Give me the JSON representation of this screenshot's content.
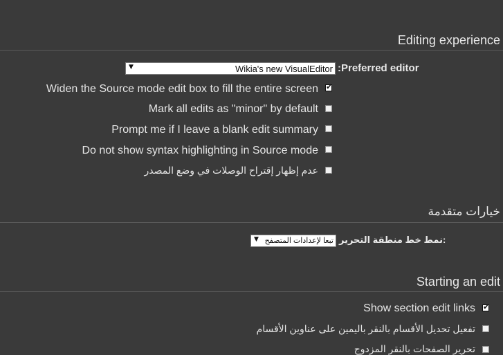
{
  "sections": {
    "editing_title": "Editing experience",
    "advanced_title": "خيارات متقدمة",
    "starting_title": "Starting an edit"
  },
  "preferred_editor": {
    "label": ":Preferred editor",
    "value": "Wikia's new VisualEditor"
  },
  "editing_options": [
    {
      "label": "Widen the Source mode edit box to fill the entire screen",
      "checked": true
    },
    {
      "label": "Mark all edits as \"minor\" by default",
      "checked": false
    },
    {
      "label": "Prompt me if I leave a blank edit summary",
      "checked": false
    },
    {
      "label": "Do not show syntax highlighting in Source mode",
      "checked": false
    },
    {
      "label": "عدم إظهار إقتراح الوصلات في وضع المصدر",
      "checked": false
    }
  ],
  "font_style": {
    "label": "نمط خط منطقة التحرير:",
    "value": "تبعا لإعدادات المتصفح"
  },
  "starting_options": [
    {
      "label": "Show section edit links",
      "checked": true
    },
    {
      "label": "تفعيل تحديل الأقسام بالنقر باليمين على عناوين الأقسام",
      "checked": false
    },
    {
      "label": "تحرير الصفحات بالنقر المزدوج",
      "checked": false
    }
  ],
  "icons": {
    "dropdown": "▼",
    "check": "✔"
  }
}
